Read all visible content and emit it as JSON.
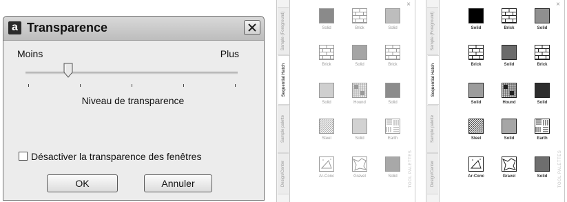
{
  "dialog": {
    "icon_letter": "a",
    "title": "Transparence",
    "label_min": "Moins",
    "label_max": "Plus",
    "slider_value_fraction": 0.2,
    "slider_caption": "Niveau de transparence",
    "checkbox_label": "Désactiver la transparence des fenêtres",
    "checkbox_checked": false,
    "ok_label": "OK",
    "cancel_label": "Annuler"
  },
  "palettes": [
    {
      "style": "faded",
      "side_tabs": [
        "Sample (Foreground)",
        "Sequential Hatch",
        "Sample palette",
        "Design/Center"
      ],
      "active_tab": 1,
      "vertical_label": "TOOL PALETTES",
      "tiles": [
        {
          "label": "Solid",
          "pattern": "solid",
          "color": "#8a8a8a"
        },
        {
          "label": "Brick",
          "pattern": "brick",
          "color": "#ffffff"
        },
        {
          "label": "Solid",
          "pattern": "solid",
          "color": "#bdbdbd"
        },
        {
          "label": "Brick",
          "pattern": "brick",
          "color": "#ffffff"
        },
        {
          "label": "Solid",
          "pattern": "solid",
          "color": "#a5a5a5"
        },
        {
          "label": "Brick",
          "pattern": "brick",
          "color": "#ffffff"
        },
        {
          "label": "Solid",
          "pattern": "solid",
          "color": "#cfcfcf"
        },
        {
          "label": "Hound",
          "pattern": "hound",
          "color": "#ffffff"
        },
        {
          "label": "Solid",
          "pattern": "solid",
          "color": "#8c8c8c"
        },
        {
          "label": "Steel",
          "pattern": "steel",
          "color": "#ffffff"
        },
        {
          "label": "Solid",
          "pattern": "solid",
          "color": "#d2d2d2"
        },
        {
          "label": "Earth",
          "pattern": "earth",
          "color": "#ffffff"
        },
        {
          "label": "Ar-Conc",
          "pattern": "conc",
          "color": "#ffffff"
        },
        {
          "label": "Gravel",
          "pattern": "gravel",
          "color": "#ffffff"
        },
        {
          "label": "Solid",
          "pattern": "solid",
          "color": "#a8a8a8"
        }
      ]
    },
    {
      "style": "dark",
      "side_tabs": [
        "Sample (Foreground)",
        "Sequential Hatch",
        "Sample palette",
        "Design/Center"
      ],
      "active_tab": 1,
      "vertical_label": "TOOL PALETTES",
      "tiles": [
        {
          "label": "Solid",
          "pattern": "solid",
          "color": "#000000"
        },
        {
          "label": "Brick",
          "pattern": "brick",
          "color": "#ffffff"
        },
        {
          "label": "Solid",
          "pattern": "solid",
          "color": "#8f8f8f"
        },
        {
          "label": "Brick",
          "pattern": "brick",
          "color": "#ffffff"
        },
        {
          "label": "Solid",
          "pattern": "solid",
          "color": "#6b6b6b"
        },
        {
          "label": "Brick",
          "pattern": "brick",
          "color": "#ffffff"
        },
        {
          "label": "Solid",
          "pattern": "solid",
          "color": "#9c9c9c"
        },
        {
          "label": "Hound",
          "pattern": "hound",
          "color": "#ffffff"
        },
        {
          "label": "Solid",
          "pattern": "solid",
          "color": "#2d2d2d"
        },
        {
          "label": "Steel",
          "pattern": "steel",
          "color": "#ffffff"
        },
        {
          "label": "Solid",
          "pattern": "solid",
          "color": "#a6a6a6"
        },
        {
          "label": "Earth",
          "pattern": "earth",
          "color": "#ffffff"
        },
        {
          "label": "Ar-Conc",
          "pattern": "conc",
          "color": "#ffffff"
        },
        {
          "label": "Gravel",
          "pattern": "gravel",
          "color": "#ffffff"
        },
        {
          "label": "Solid",
          "pattern": "solid",
          "color": "#6e6e6e"
        }
      ]
    }
  ]
}
